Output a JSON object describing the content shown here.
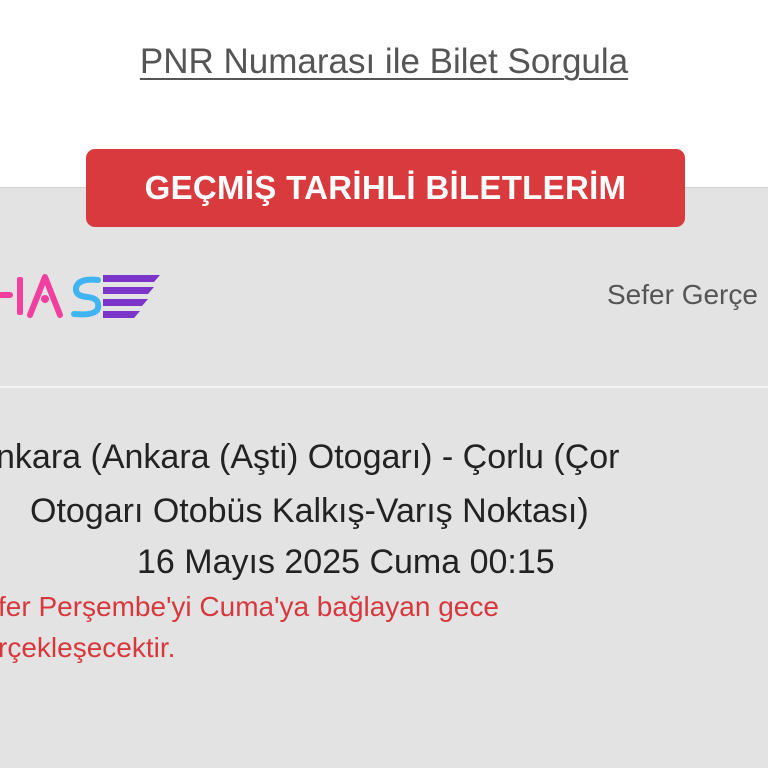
{
  "pnr_query_link": "PNR Numarası ile Bilet Sorgula",
  "history_button_label": "GEÇMİŞ TARİHLİ BİLETLERİM",
  "ticket": {
    "company_logo_text": "HAS",
    "status_text": "Sefer Gerçe",
    "route_line_1": "nkara (Ankara (Aşti) Otogarı) - Çorlu (Çor",
    "route_line_2": "Otogarı Otobüs Kalkış-Varış Noktası)",
    "departure_datetime": "16 Mayıs 2025 Cuma 00:15",
    "notice_line_1": "fer Perşembe'yi Cuma'ya bağlayan gece",
    "notice_line_2": "rçekleşecektir."
  },
  "colors": {
    "accent_red": "#d93a3e",
    "logo_purple": "#7b35c8",
    "logo_pink": "#f23f9f",
    "logo_blue": "#3fb4f1"
  }
}
